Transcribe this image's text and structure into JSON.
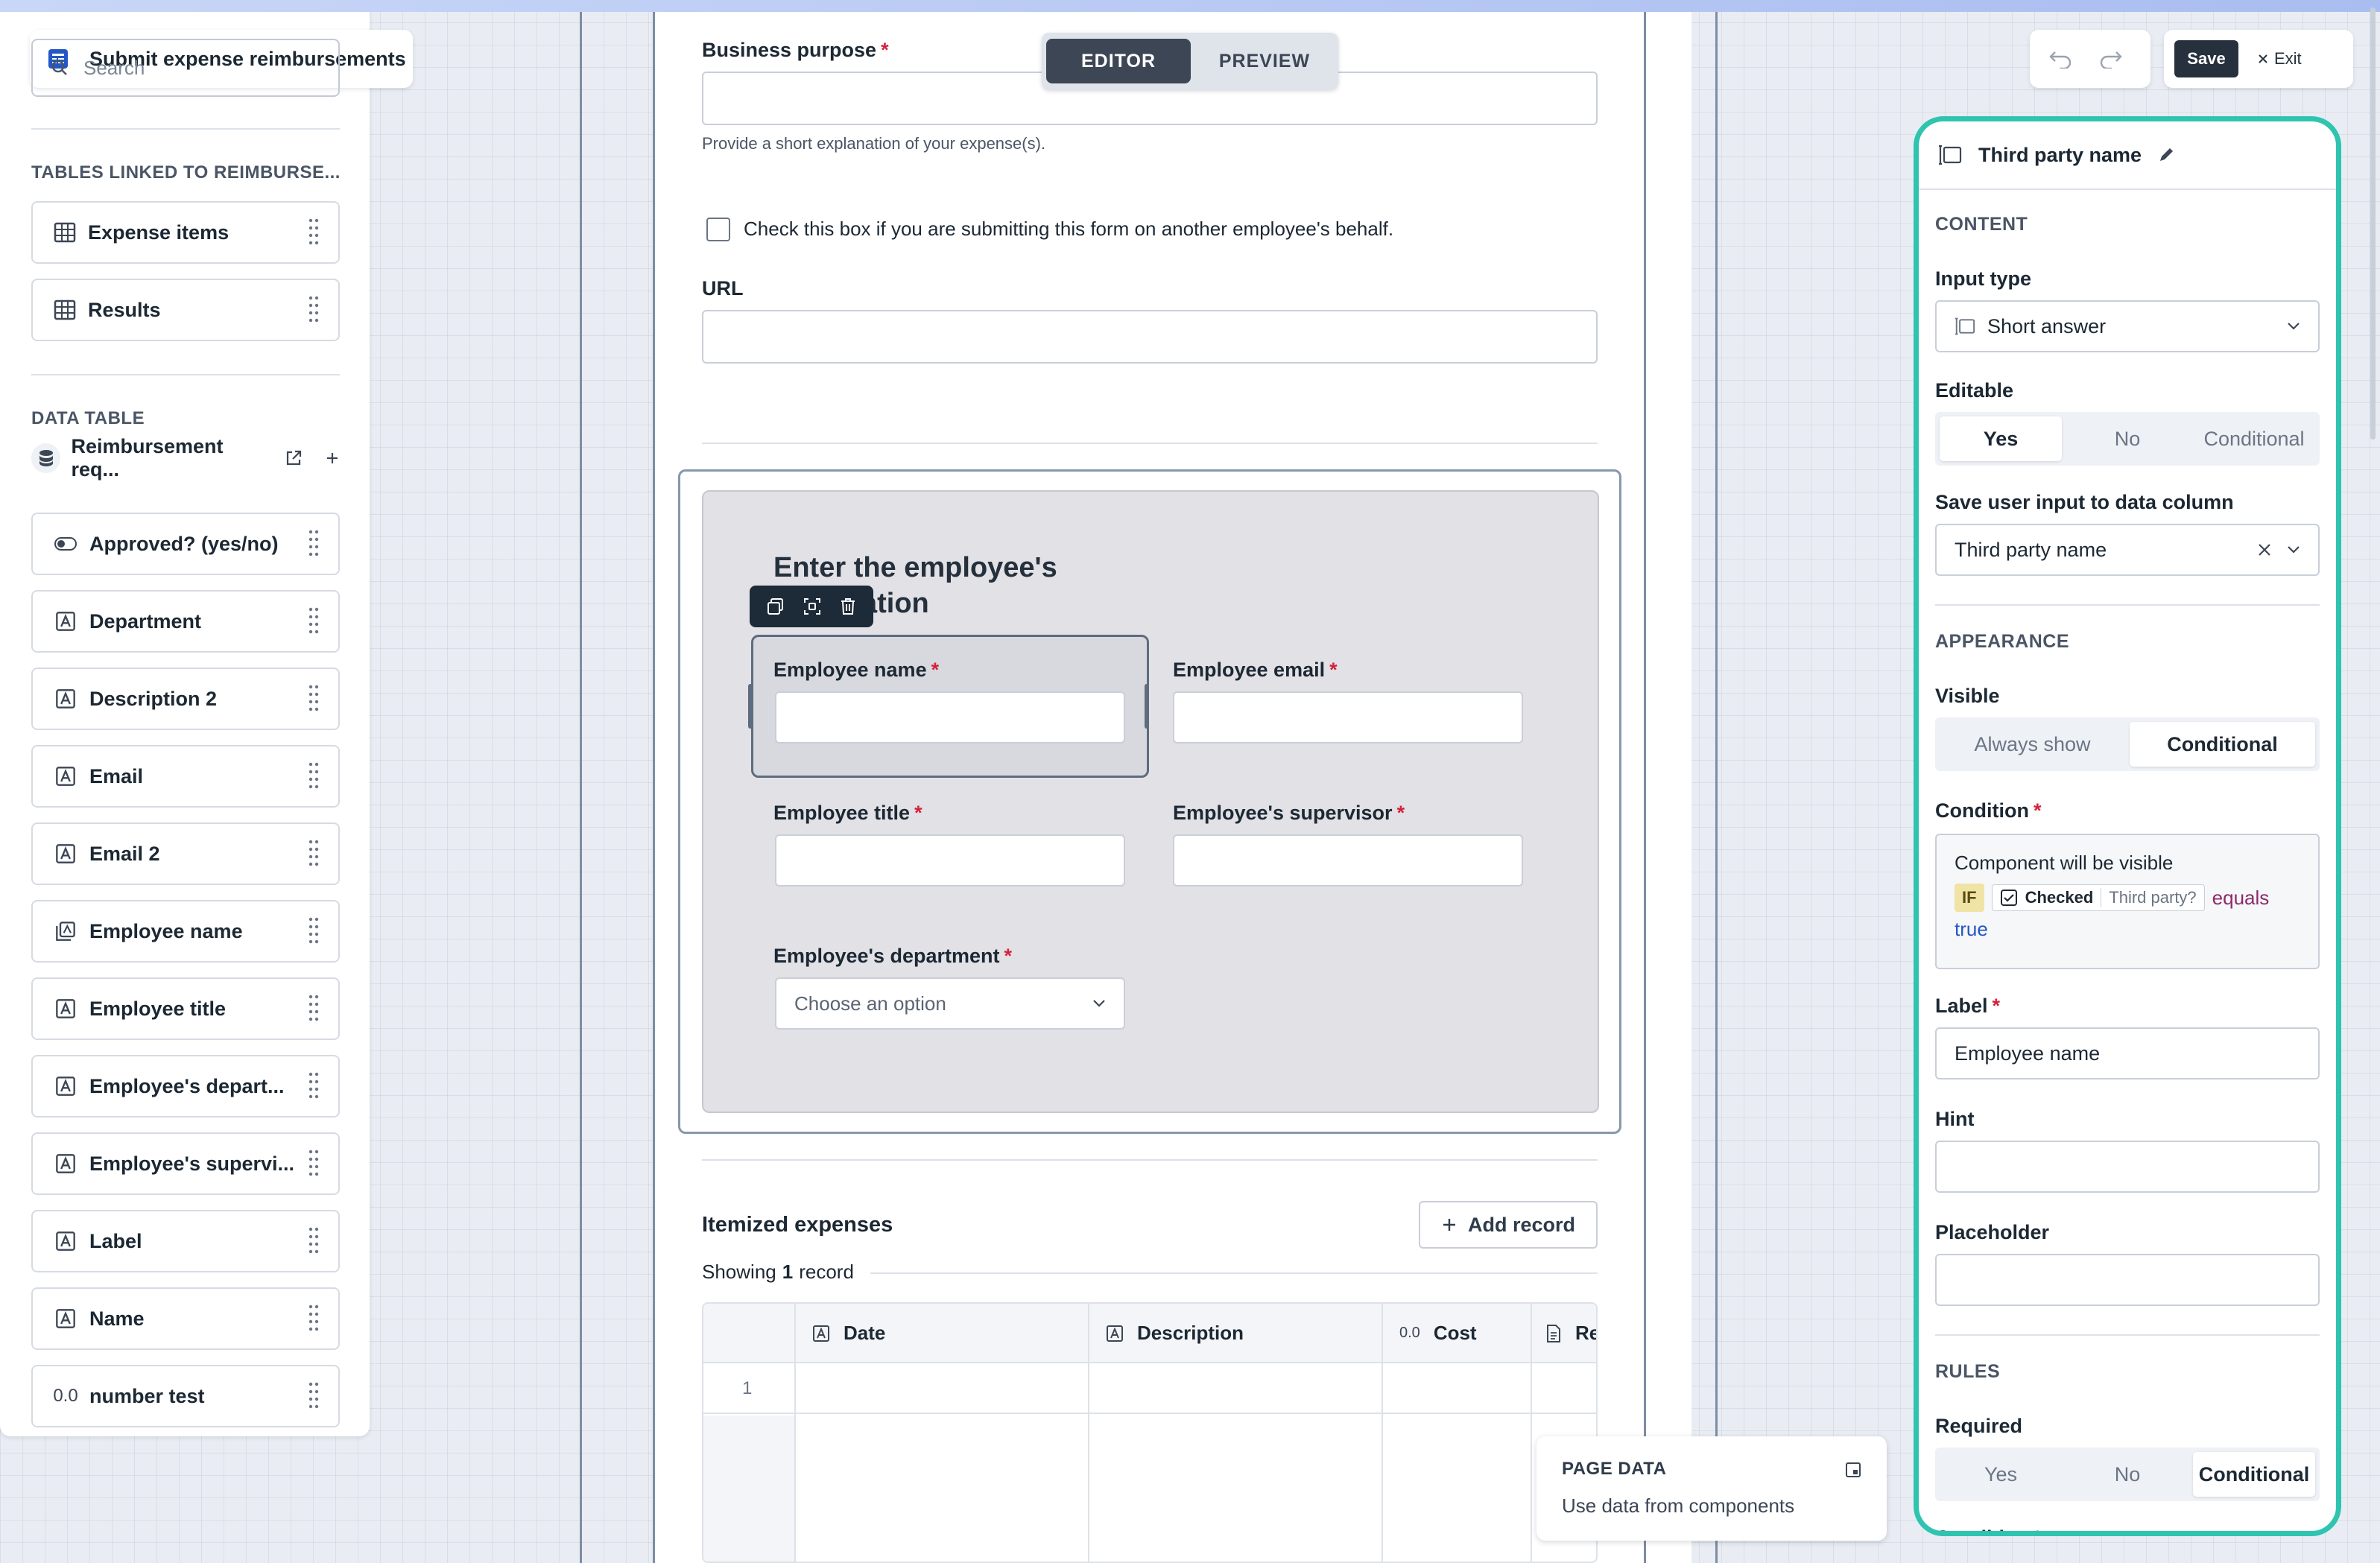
{
  "app": {
    "title": "Submit expense reimbursements"
  },
  "left": {
    "search_placeholder": "Search",
    "linked_heading": "TABLES LINKED TO REIMBURSE...",
    "linked_tables": [
      {
        "label": "Expense items",
        "icon": "table-icon"
      },
      {
        "label": "Results",
        "icon": "table-icon"
      }
    ],
    "data_table_heading": "DATA TABLE",
    "data_table_name": "Reimbursement req...",
    "fields": [
      {
        "label": "Approved? (yes/no)",
        "icon": "toggle-icon"
      },
      {
        "label": "Department",
        "icon": "text-field-icon"
      },
      {
        "label": "Description 2",
        "icon": "text-field-icon"
      },
      {
        "label": "Email",
        "icon": "text-field-icon"
      },
      {
        "label": "Email 2",
        "icon": "text-field-icon"
      },
      {
        "label": "Employee name",
        "icon": "linked-field-icon"
      },
      {
        "label": "Employee title",
        "icon": "text-field-icon"
      },
      {
        "label": "Employee's depart...",
        "icon": "text-field-icon"
      },
      {
        "label": "Employee's supervi...",
        "icon": "text-field-icon"
      },
      {
        "label": "Label",
        "icon": "text-field-icon"
      },
      {
        "label": "Name",
        "icon": "text-field-icon"
      },
      {
        "label": "number test",
        "icon": "number-icon"
      }
    ]
  },
  "mode_toggle": {
    "editor": "EDITOR",
    "preview": "PREVIEW",
    "active": "EDITOR"
  },
  "form": {
    "business_purpose": {
      "label": "Business purpose",
      "hint": "Provide a short explanation of your expense(s)."
    },
    "behalf_checkbox": "Check this box if you are submitting this form on another employee's behalf.",
    "url_label": "URL",
    "section_title": "Enter the employee's information",
    "section_title_visible": "Enter the employee's",
    "section_title_visible_2": "ation",
    "employee_name": "Employee name",
    "employee_email": "Employee email",
    "employee_title": "Employee title",
    "employee_supervisor": "Employee's supervisor",
    "employee_department": "Employee's department",
    "department_placeholder": "Choose an option",
    "itemized_title": "Itemized expenses",
    "add_record": "Add record",
    "showing_prefix": "Showing",
    "showing_count": "1",
    "showing_suffix": "record",
    "columns": [
      "Date",
      "Description",
      "Cost",
      "Re"
    ],
    "row_number": "1"
  },
  "page_data": {
    "title": "PAGE DATA",
    "subtitle": "Use data from components"
  },
  "toolbar": {
    "save": "Save",
    "exit": "Exit"
  },
  "right": {
    "title": "Third party name",
    "content_heading": "CONTENT",
    "input_type_label": "Input type",
    "input_type_value": "Short answer",
    "editable_label": "Editable",
    "editable_options": [
      "Yes",
      "No",
      "Conditional"
    ],
    "editable_selected": "Yes",
    "save_column_label": "Save user input to data column",
    "save_column_value": "Third party name",
    "appearance_heading": "APPEARANCE",
    "visible_label": "Visible",
    "visible_options": [
      "Always show",
      "Conditional"
    ],
    "visible_selected": "Conditional",
    "condition_label": "Condition",
    "condition_text": "Component will be visible",
    "condition_if": "IF",
    "condition_checked": "Checked",
    "condition_field": "Third party?",
    "condition_op": "equals",
    "condition_value": "true",
    "label_label": "Label",
    "label_value": "Employee name",
    "hint_label": "Hint",
    "placeholder_label": "Placeholder",
    "rules_heading": "RULES",
    "required_label": "Required",
    "required_options": [
      "Yes",
      "No",
      "Conditional"
    ],
    "required_selected": "Conditional",
    "condition2_label": "Condition"
  },
  "colors": {
    "accent_outline": "#2ec4b0",
    "required": "#d5213b",
    "dark": "#27313d"
  }
}
